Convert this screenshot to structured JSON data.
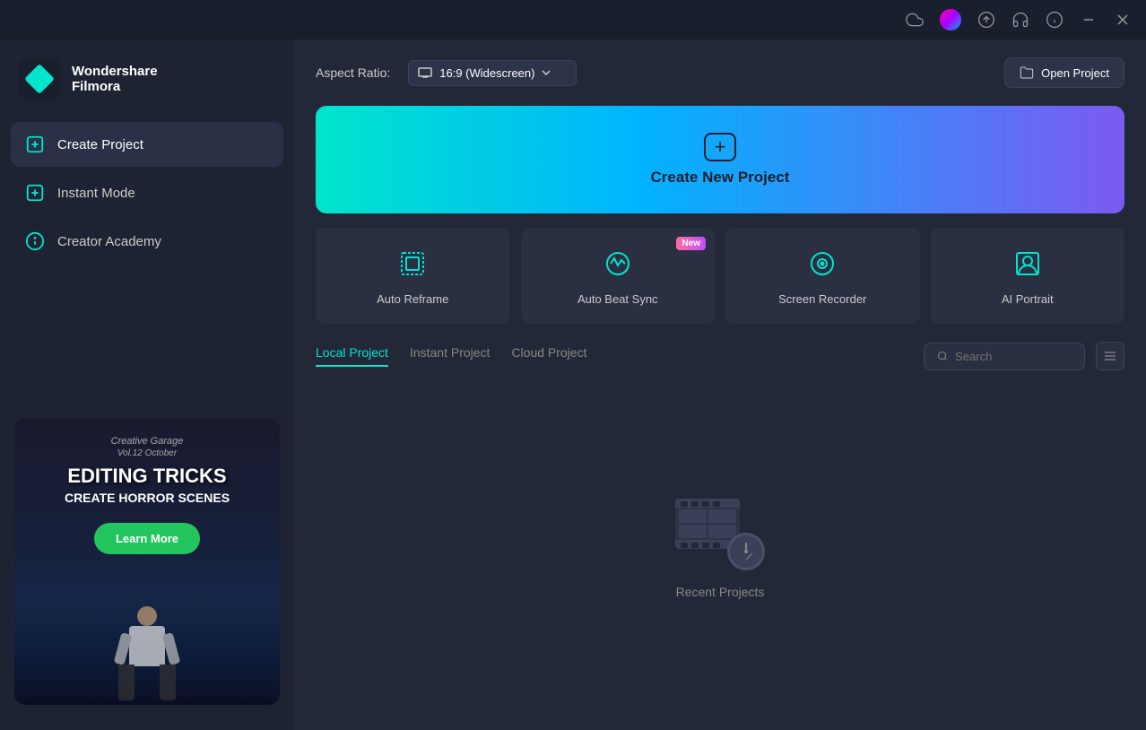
{
  "app": {
    "name": "Wondershare",
    "subtitle": "Filmora"
  },
  "titlebar": {
    "icons": [
      "cloud",
      "profile",
      "upload",
      "headset",
      "info",
      "minimize",
      "close"
    ]
  },
  "sidebar": {
    "nav_items": [
      {
        "id": "create-project",
        "label": "Create Project",
        "active": true
      },
      {
        "id": "instant-mode",
        "label": "Instant Mode",
        "active": false
      },
      {
        "id": "creator-academy",
        "label": "Creator Academy",
        "active": false
      }
    ],
    "banner": {
      "small_title": "Creative Garage",
      "vol": "Vol.12 October",
      "headline": "EDITING TRICKS",
      "subheadline": "CREATE HORROR SCENES",
      "button_label": "Learn More"
    }
  },
  "content": {
    "aspect_ratio": {
      "label": "Aspect Ratio:",
      "value": "16:9 (Widescreen)"
    },
    "open_project_label": "Open Project",
    "create_new_project_label": "Create New Project",
    "tools": [
      {
        "id": "auto-reframe",
        "label": "Auto Reframe",
        "new": false
      },
      {
        "id": "auto-beat-sync",
        "label": "Auto Beat Sync",
        "new": true
      },
      {
        "id": "screen-recorder",
        "label": "Screen Recorder",
        "new": false
      },
      {
        "id": "ai-portrait",
        "label": "AI Portrait",
        "new": false
      }
    ],
    "project_tabs": [
      {
        "id": "local",
        "label": "Local Project",
        "active": true
      },
      {
        "id": "instant",
        "label": "Instant Project",
        "active": false
      },
      {
        "id": "cloud",
        "label": "Cloud Project",
        "active": false
      }
    ],
    "search_placeholder": "Search",
    "recent_projects_label": "Recent Projects",
    "new_badge_label": "New"
  }
}
